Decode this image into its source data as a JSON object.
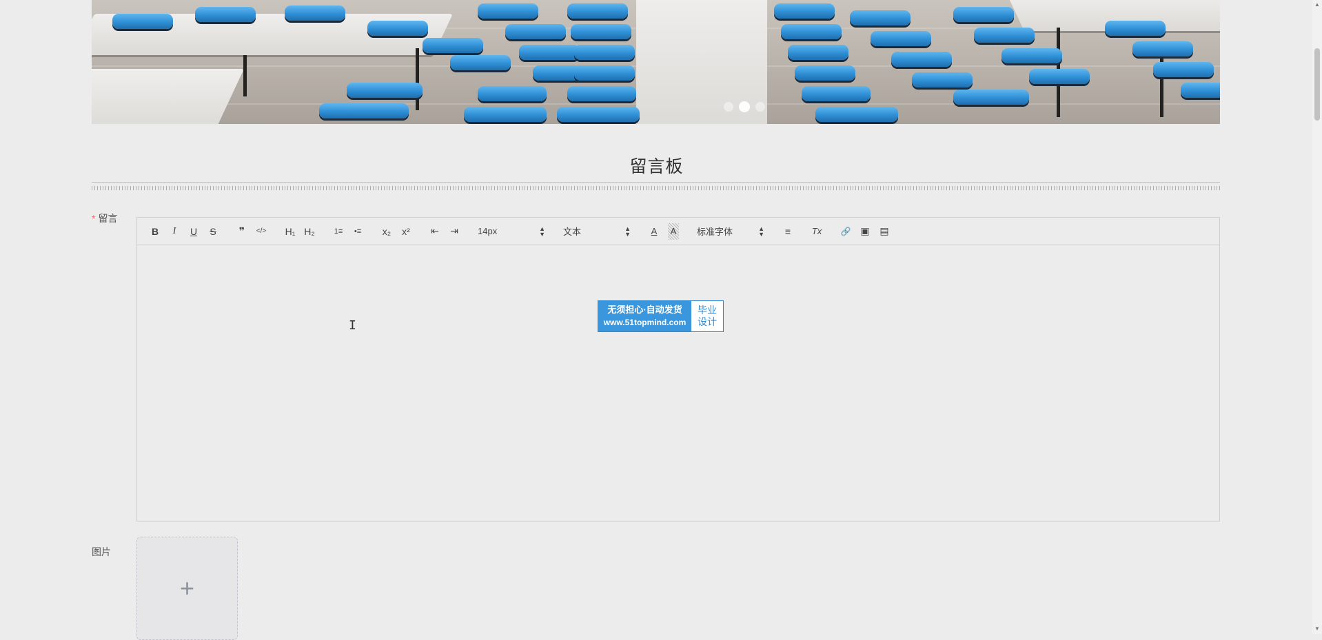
{
  "carousel": {
    "slide_count": 3,
    "active_index": 1
  },
  "section_title": "留言板",
  "form": {
    "message": {
      "required_mark": "*",
      "label": "留言"
    },
    "image": {
      "label": "图片",
      "upload_symbol": "+"
    }
  },
  "editor": {
    "toolbar": {
      "bold": "B",
      "italic": "I",
      "underline": "U",
      "strike": "S",
      "blockquote": "❞",
      "code": "</>",
      "h1": "H₁",
      "h2": "H₂",
      "ordered_list": "1≡",
      "bullet_list": "•≡",
      "subscript": "x₂",
      "superscript": "x²",
      "outdent": "⇤",
      "indent": "⇥",
      "font_size": "14px",
      "heading_select": "文本",
      "font_color": "A",
      "background_color": "A",
      "font_family": "标准字体",
      "align": "≡",
      "clean": "Tx",
      "link": "🔗",
      "image": "▣",
      "video": "▤"
    },
    "content": ""
  },
  "watermark": {
    "line1": "无须担心·自动发货",
    "line2": "www.51topmind.com",
    "badge_line1": "毕业",
    "badge_line2": "设计"
  },
  "colors": {
    "background": "#ececec",
    "required": "#f56c6c",
    "watermark_blue": "#3a97dd"
  }
}
